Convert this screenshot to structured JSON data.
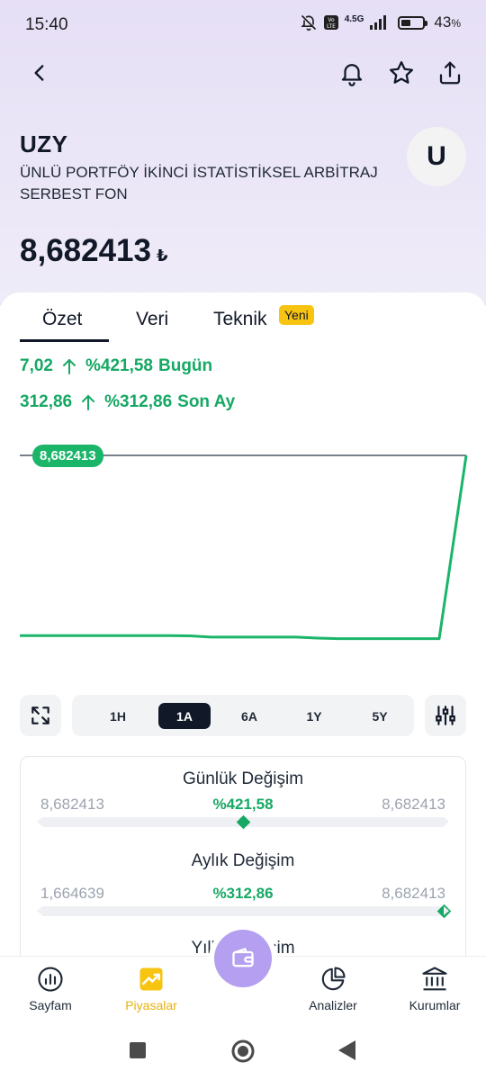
{
  "status_bar": {
    "time": "15:40",
    "network": "4.5G",
    "battery": "43",
    "battery_unit": "%"
  },
  "header": {
    "back_icon": "chevron-left-icon",
    "bell_icon": "bell-icon",
    "star_icon": "star-icon",
    "share_icon": "share-icon"
  },
  "fund": {
    "code": "UZY",
    "name": "ÜNLÜ PORTFÖY İKİNCİ İSTATİSTİKSEL ARBİTRAJ SERBEST FON",
    "avatar_letter": "U",
    "price": "8,682413",
    "currency": "₺"
  },
  "tabs": [
    {
      "label": "Özet",
      "active": true
    },
    {
      "label": "Veri",
      "active": false
    },
    {
      "label": "Teknik",
      "active": false,
      "badge": "Yeni"
    }
  ],
  "changes": [
    {
      "value": "7,02",
      "percent": "%421,58",
      "period": "Bugün"
    },
    {
      "value": "312,86",
      "percent": "%312,86",
      "period": "Son Ay"
    }
  ],
  "chart": {
    "price_tag": "8,682413",
    "line_color": "#1bb56a",
    "tag_color": "#1bb56a"
  },
  "chart_data": {
    "type": "line",
    "x": [
      0,
      1,
      2,
      3,
      4,
      5,
      6,
      7,
      8,
      9,
      10,
      11,
      12,
      13,
      14,
      15,
      16,
      17,
      18,
      19,
      20,
      21
    ],
    "values": [
      1.66,
      1.66,
      1.66,
      1.66,
      1.66,
      1.66,
      1.66,
      1.66,
      1.65,
      1.6,
      1.6,
      1.6,
      1.6,
      1.6,
      1.56,
      1.54,
      1.54,
      1.54,
      1.54,
      1.54,
      1.54,
      8.682413
    ],
    "reference_line": 8.682413,
    "ylim": [
      1.0,
      8.682413
    ]
  },
  "ranges": [
    {
      "label": "1H",
      "active": false
    },
    {
      "label": "1A",
      "active": true
    },
    {
      "label": "6A",
      "active": false
    },
    {
      "label": "1Y",
      "active": false
    },
    {
      "label": "5Y",
      "active": false
    }
  ],
  "stats": [
    {
      "title": "Günlük Değişim",
      "low": "8,682413",
      "change": "%421,58",
      "high": "8,682413",
      "position": 0.5
    },
    {
      "title": "Aylık Değişim",
      "low": "1,664639",
      "change": "%312,86",
      "high": "8,682413",
      "position": 1.0
    },
    {
      "title": "Yıllık Değişim"
    }
  ],
  "bottom_nav": [
    {
      "label": "Sayfam",
      "icon": "chart-bar-icon",
      "active": false
    },
    {
      "label": "Piyasalar",
      "icon": "trending-up-icon",
      "active": true
    },
    {
      "label": "Analizler",
      "icon": "pie-chart-icon",
      "active": false
    },
    {
      "label": "Kurumlar",
      "icon": "bank-icon",
      "active": false
    }
  ],
  "fab_icon": "wallet-icon",
  "colors": {
    "accent_green": "#16a864",
    "active_nav": "#e8b10c",
    "fab": "#b59ff0",
    "badge": "#f7c411"
  }
}
